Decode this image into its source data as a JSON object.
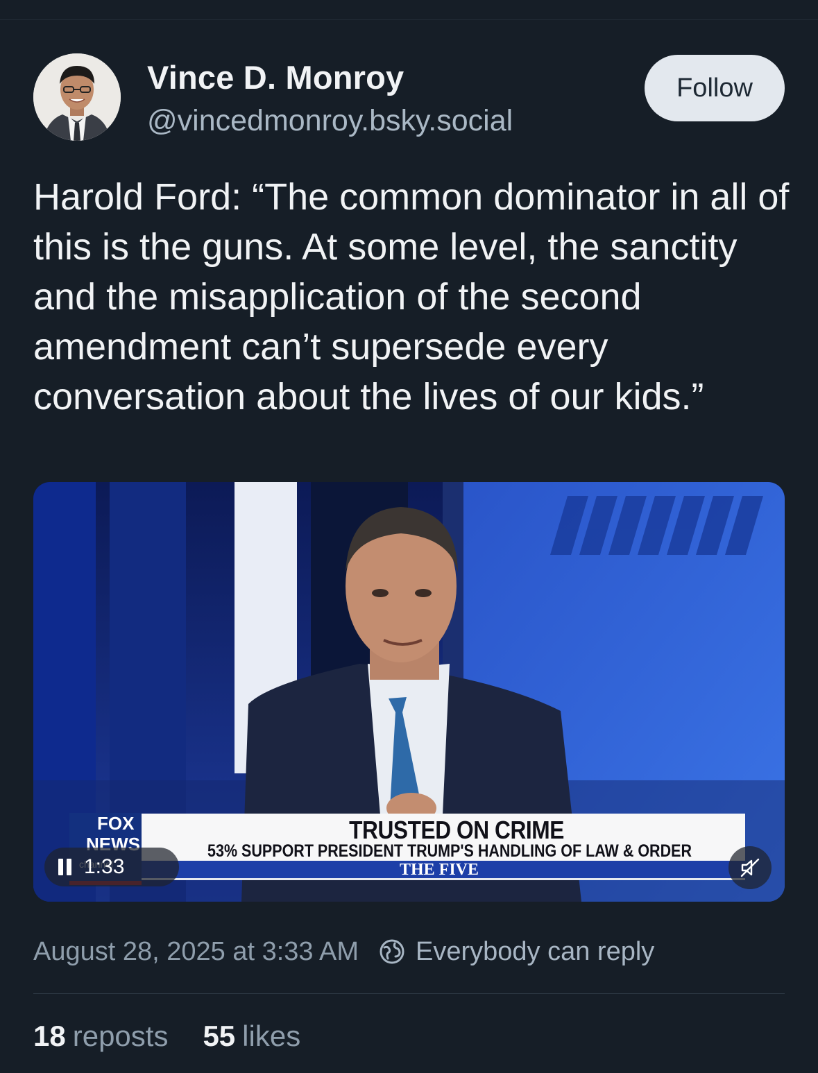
{
  "author": {
    "display_name": "Vince D. Monroy",
    "handle": "@vincedmonroy.bsky.social",
    "avatar_icon": "profile-photo"
  },
  "follow_button": {
    "label": "Follow"
  },
  "post": {
    "text": "Harold Ford: “The common dominator in all of this is the guns. At some level, the sanctity and the misapplication of the second amendment can’t supersede every conversation about the lives of our kids.”"
  },
  "video": {
    "chyron_headline": "TRUSTED ON CRIME",
    "chyron_subline": "53% SUPPORT PRESIDENT TRUMP'S HANDLING OF LAW & ORDER",
    "show_name": "THE FIVE",
    "network_logo_top": "FOX",
    "network_logo_bottom": "NEWS",
    "network_logo_sub": "channel",
    "time_display": "1:33",
    "pause_icon": "pause-icon",
    "mute_icon": "speaker-muted-icon"
  },
  "meta": {
    "date": "August 28, 2025 at 3:33 AM",
    "reply_icon": "globe-icon",
    "reply_setting": "Everybody can reply"
  },
  "stats": {
    "reposts_count": "18",
    "reposts_label": "reposts",
    "likes_count": "55",
    "likes_label": "likes"
  },
  "colors": {
    "background": "#161e27",
    "follow_button_bg": "#e3e8ee",
    "secondary_text": "#8f9eac"
  }
}
